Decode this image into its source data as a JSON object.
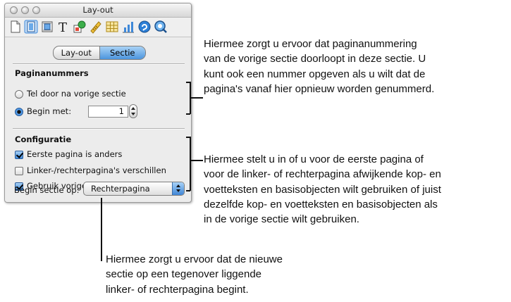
{
  "window": {
    "title": "Lay-out"
  },
  "toolbar": {
    "icons": [
      "document-icon",
      "layout-icon",
      "wrap-icon",
      "text-icon",
      "graphic-icon",
      "metrics-icon",
      "table-icon",
      "chart-icon",
      "link-icon",
      "quicktime-icon"
    ]
  },
  "tabs": {
    "layout": "Lay-out",
    "section": "Sectie",
    "active": "Sectie"
  },
  "page_numbers": {
    "header": "Paginanummers",
    "continue_label": "Tel door na vorige sectie",
    "start_at_label": "Begin met:",
    "start_at_value": "1",
    "selected": "start_at"
  },
  "configuration": {
    "header": "Configuratie",
    "first_page_different": {
      "label": "Eerste pagina is anders",
      "checked": true
    },
    "left_right_different": {
      "label": "Linker-/rechterpagina's verschillen",
      "checked": false
    },
    "use_previous_headers": {
      "label": "Gebruik vorige kop- en voetteksten",
      "checked": true
    }
  },
  "section_start": {
    "label": "Begin sectie op:",
    "value": "Rechterpagina"
  },
  "callouts": {
    "page_numbering": "Hiermee zorgt u ervoor dat paginanummering\nvan de vorige sectie doorloopt in deze sectie. U\nkunt ook een nummer opgeven als u wilt dat de\npagina's vanaf hier opnieuw worden genummerd.",
    "configuration": "Hiermee stelt u in of u voor de eerste pagina of\nvoor de linker- of rechterpagina afwijkende kop- en\nvoetteksten en basisobjecten wilt gebruiken of juist\ndezelfde kop- en voetteksten en basisobjecten als\nin de vorige sectie wilt gebruiken.",
    "section_start": "Hiermee zorgt u ervoor dat de nieuwe\nsectie op een tegenover liggende\nlinker- of rechterpagina begint."
  },
  "colors": {
    "accent": "#3f88d8",
    "panel": "#ececec"
  }
}
